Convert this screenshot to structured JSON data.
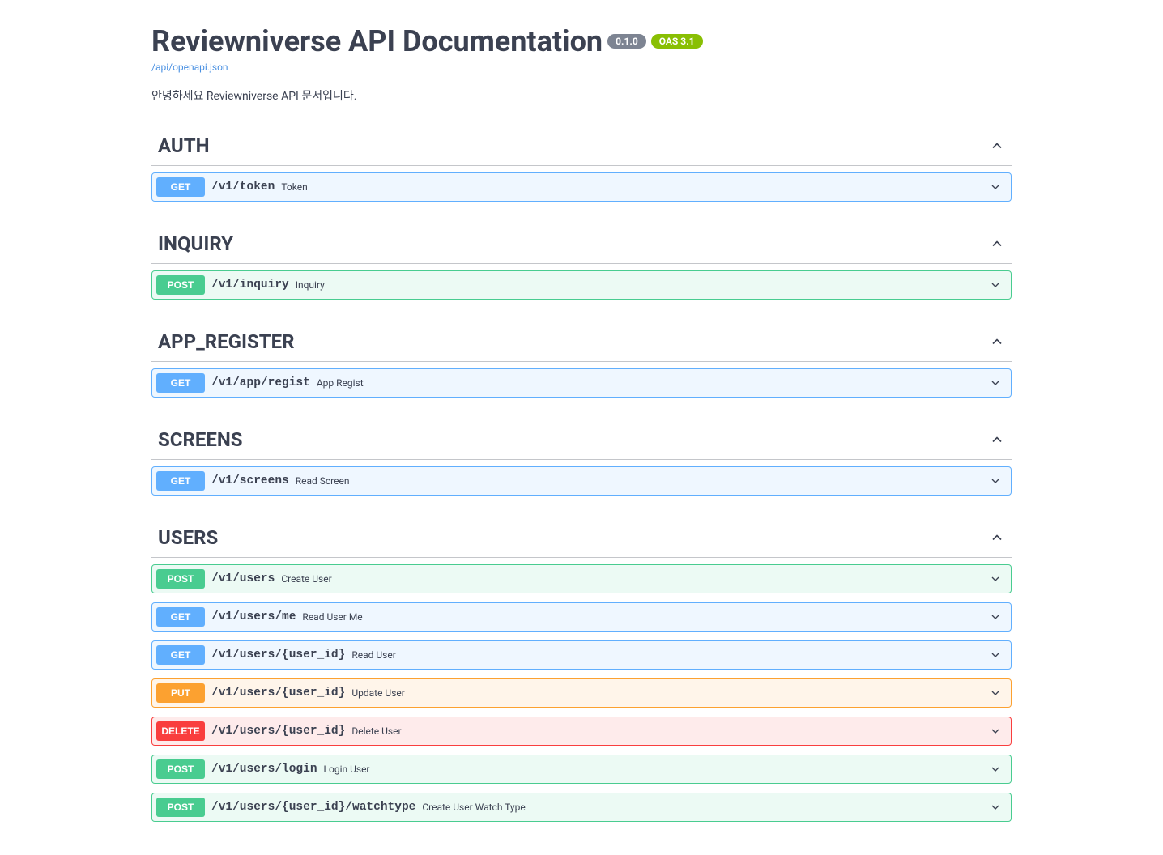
{
  "header": {
    "title": "Reviewniverse API Documentation",
    "version": "0.1.0",
    "oas": "OAS 3.1",
    "spec_url": "/api/openapi.json",
    "description": "안녕하세요 Reviewniverse API 문서입니다."
  },
  "tags": [
    {
      "name": "AUTH",
      "operations": [
        {
          "method": "GET",
          "path": "/v1/token",
          "summary": "Token"
        }
      ]
    },
    {
      "name": "INQUIRY",
      "operations": [
        {
          "method": "POST",
          "path": "/v1/inquiry",
          "summary": "Inquiry"
        }
      ]
    },
    {
      "name": "APP_REGISTER",
      "operations": [
        {
          "method": "GET",
          "path": "/v1/app/regist",
          "summary": "App Regist"
        }
      ]
    },
    {
      "name": "SCREENS",
      "operations": [
        {
          "method": "GET",
          "path": "/v1/screens",
          "summary": "Read Screen"
        }
      ]
    },
    {
      "name": "USERS",
      "operations": [
        {
          "method": "POST",
          "path": "/v1/users",
          "summary": "Create User"
        },
        {
          "method": "GET",
          "path": "/v1/users/me",
          "summary": "Read User Me"
        },
        {
          "method": "GET",
          "path": "/v1/users/{user_id}",
          "summary": "Read User"
        },
        {
          "method": "PUT",
          "path": "/v1/users/{user_id}",
          "summary": "Update User"
        },
        {
          "method": "DELETE",
          "path": "/v1/users/{user_id}",
          "summary": "Delete User"
        },
        {
          "method": "POST",
          "path": "/v1/users/login",
          "summary": "Login User"
        },
        {
          "method": "POST",
          "path": "/v1/users/{user_id}/watchtype",
          "summary": "Create User Watch Type"
        }
      ]
    }
  ]
}
